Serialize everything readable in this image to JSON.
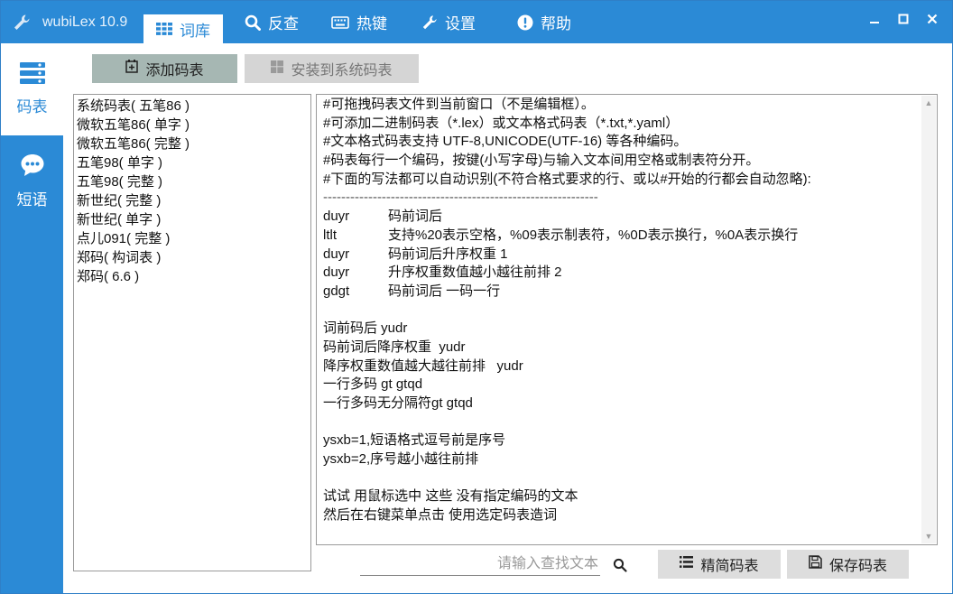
{
  "titlebar": {
    "app_title": "wubiLex 10.9",
    "tabs": [
      {
        "label": "词库",
        "icon": "grid-icon",
        "active": true
      },
      {
        "label": "反查",
        "icon": "search-icon"
      },
      {
        "label": "热键",
        "icon": "keyboard-icon"
      },
      {
        "label": "设置",
        "icon": "wrench-icon"
      },
      {
        "label": "帮助",
        "icon": "exclamation-icon"
      }
    ]
  },
  "sidebar": {
    "items": [
      {
        "label": "码表",
        "icon": "list-icon",
        "active": true
      },
      {
        "label": "短语",
        "icon": "chat-bubble-icon"
      }
    ]
  },
  "toolbar": {
    "add_label": "添加码表",
    "install_label": "安装到系统码表"
  },
  "codebook_list": [
    "系统码表( 五笔86 )",
    "微软五笔86( 单字 )",
    "微软五笔86( 完整 )",
    "五笔98( 单字 )",
    "五笔98( 完整 )",
    "新世纪( 完整 )",
    "新世纪( 单字 )",
    "点儿091( 完整 )",
    "郑码( 构词表 )",
    "郑码( 6.6 )"
  ],
  "editor": {
    "header_lines": [
      "#可拖拽码表文件到当前窗口（不是编辑框）。",
      "#可添加二进制码表（*.lex）或文本格式码表（*.txt,*.yaml）",
      "#文本格式码表支持 UTF-8,UNICODE(UTF-16) 等各种编码。",
      "#码表每行一个编码，按键(小写字母)与输入文本间用空格或制表符分开。",
      "#下面的写法都可以自动识别(不符合格式要求的行、或以#开始的行都会自动忽略):",
      "-------------------------------------------------------------"
    ],
    "code_lines": [
      {
        "code": "duyr",
        "text": "码前词后"
      },
      {
        "code": "ltlt",
        "text": "支持%20表示空格，%09表示制表符，%0D表示换行，%0A表示换行"
      },
      {
        "code": "duyr",
        "text": "码前词后升序权重 1"
      },
      {
        "code": "duyr",
        "text": "升序权重数值越小越往前排 2"
      },
      {
        "code": "gdgt",
        "text": "码前词后 一码一行"
      }
    ],
    "tail_lines": [
      "",
      "词前码后 yudr",
      "码前词后降序权重  yudr",
      "降序权重数值越大越往前排   yudr",
      "一行多码 gt gtqd",
      "一行多码无分隔符gt gtqd",
      "",
      "ysxb=1,短语格式逗号前是序号",
      "ysxb=2,序号越小越往前排",
      "",
      "试试 用鼠标选中 这些 没有指定编码的文本",
      "然后在右键菜单点击 使用选定码表造词"
    ]
  },
  "bottom": {
    "search_placeholder": "请输入查找文本",
    "simplify_label": "精简码表",
    "save_label": "保存码表"
  },
  "colors": {
    "accent": "#2b8ad6",
    "add_button": "#a6b7b3",
    "disabled_button": "#d5d5d5"
  }
}
